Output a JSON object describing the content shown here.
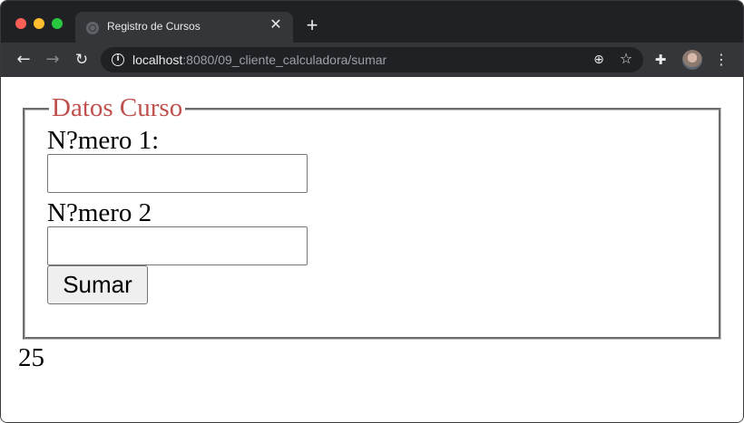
{
  "browser": {
    "tab_title": "Registro de Cursos",
    "tab_close": "✕",
    "new_tab": "+",
    "url_host": "localhost",
    "url_rest": ":8080/09_cliente_calculadora/sumar",
    "icons": {
      "back": "back-arrow-icon",
      "forward": "forward-arrow-icon",
      "reload": "reload-icon",
      "info": "info-icon",
      "zoom": "zoom-icon",
      "bookmark": "star-icon",
      "extensions": "puzzle-icon",
      "menu": "kebab-menu-icon"
    },
    "colors": {
      "frame": "#202124",
      "toolbar": "#35363a"
    }
  },
  "page": {
    "legend": "Datos Curso",
    "label1": "N?mero 1:",
    "input1_value": "",
    "label2": "N?mero 2",
    "input2_value": "",
    "submit_label": "Sumar",
    "result": "25",
    "colors": {
      "legend": "#c0504d"
    }
  }
}
